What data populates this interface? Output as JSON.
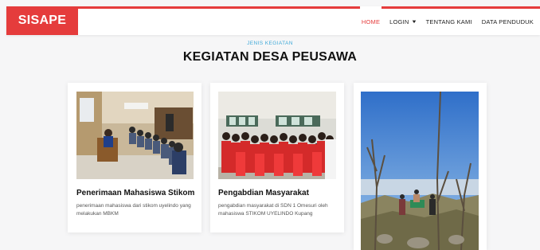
{
  "brand": {
    "name": "SISAPE"
  },
  "nav": {
    "items": [
      {
        "label": "HOME",
        "active": true
      },
      {
        "label": "LOGIN",
        "dropdown": true
      },
      {
        "label": "TENTANG KAMI"
      },
      {
        "label": "DATA PENDUDUK"
      }
    ]
  },
  "section": {
    "subtitle": "JENIS KEGIATAN",
    "title": "KEGIATAN DESA PEUSAWA"
  },
  "cards": [
    {
      "title": "Penerimaan Mahasiswa Stikom",
      "description": "penerimaan mahasiswa dari stikom uyelindo yang melakukan MBKM",
      "image": "classroom-meeting-photo"
    },
    {
      "title": "Pengabdian Masyarakat",
      "description": "pengabdian masyarakat di SDN 1 Omesuri oleh mahasiswa STIKOM UYELINDO Kupang",
      "image": "group-students-red-shirts-photo"
    },
    {
      "title": "",
      "description": "",
      "image": "mountain-summit-group-photo"
    }
  ],
  "colors": {
    "accent": "#e53c3c",
    "subtitle": "#3fa9d8",
    "background": "#f6f6f7"
  }
}
